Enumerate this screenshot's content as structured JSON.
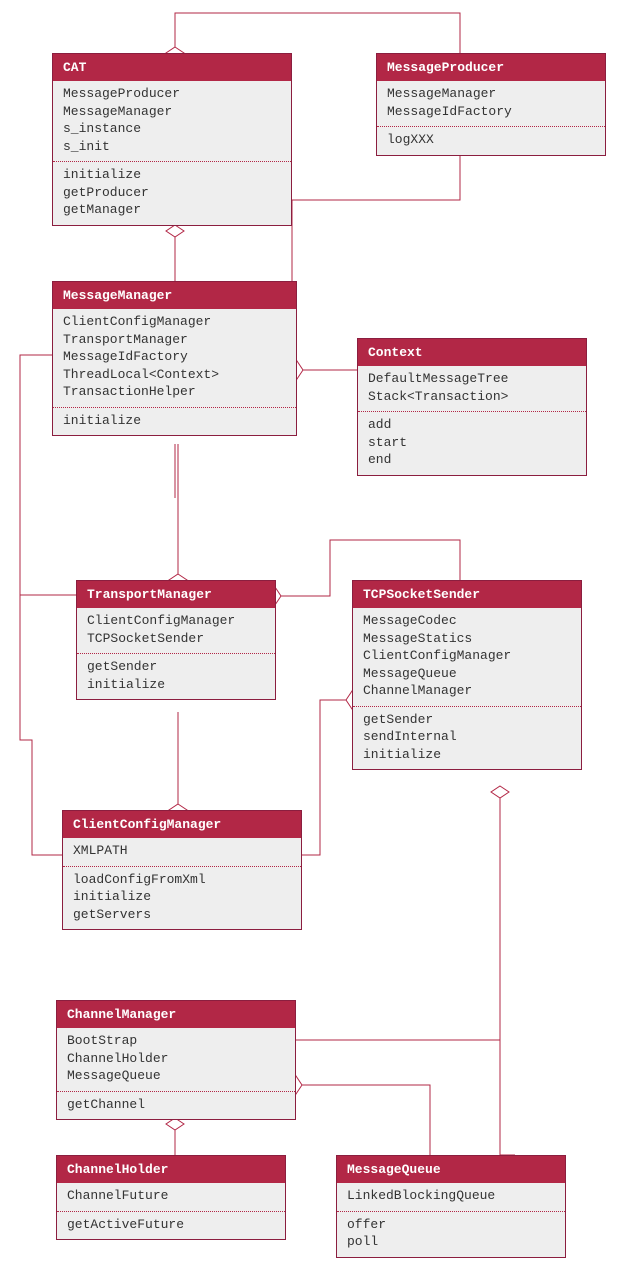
{
  "colors": {
    "header": "#b22746",
    "bodyBg": "#eee",
    "border": "#8b1e3f",
    "line": "#b22746"
  },
  "classes": {
    "CAT": {
      "name": "CAT",
      "attrs": [
        "MessageProducer",
        "MessageManager",
        "s_instance",
        "s_init"
      ],
      "methods": [
        "initialize",
        "getProducer",
        "getManager"
      ]
    },
    "MessageProducer": {
      "name": "MessageProducer",
      "attrs": [
        "MessageManager",
        "MessageIdFactory"
      ],
      "methods": [
        "logXXX"
      ]
    },
    "MessageManager": {
      "name": "MessageManager",
      "attrs": [
        "ClientConfigManager",
        "TransportManager",
        "MessageIdFactory",
        "ThreadLocal<Context>",
        "TransactionHelper"
      ],
      "methods": [
        "initialize"
      ]
    },
    "Context": {
      "name": "Context",
      "attrs": [
        "DefaultMessageTree",
        "Stack<Transaction>"
      ],
      "methods": [
        "add",
        "start",
        "end"
      ]
    },
    "TransportManager": {
      "name": "TransportManager",
      "attrs": [
        "ClientConfigManager",
        "TCPSocketSender"
      ],
      "methods": [
        "getSender",
        "initialize"
      ]
    },
    "TCPSocketSender": {
      "name": "TCPSocketSender",
      "attrs": [
        "MessageCodec",
        "MessageStatics",
        "ClientConfigManager",
        "MessageQueue",
        "ChannelManager"
      ],
      "methods": [
        "getSender",
        "sendInternal",
        "initialize"
      ]
    },
    "ClientConfigManager": {
      "name": "ClientConfigManager",
      "attrs": [
        "XMLPATH"
      ],
      "methods": [
        "loadConfigFromXml",
        "initialize",
        "getServers"
      ]
    },
    "ChannelManager": {
      "name": "ChannelManager",
      "attrs": [
        "BootStrap",
        "ChannelHolder",
        "MessageQueue"
      ],
      "methods": [
        "getChannel"
      ]
    },
    "ChannelHolder": {
      "name": "ChannelHolder",
      "attrs": [
        "ChannelFuture"
      ],
      "methods": [
        "getActiveFuture"
      ]
    },
    "MessageQueue": {
      "name": "MessageQueue",
      "attrs": [
        "LinkedBlockingQueue"
      ],
      "methods": [
        "offer",
        "poll"
      ]
    }
  }
}
